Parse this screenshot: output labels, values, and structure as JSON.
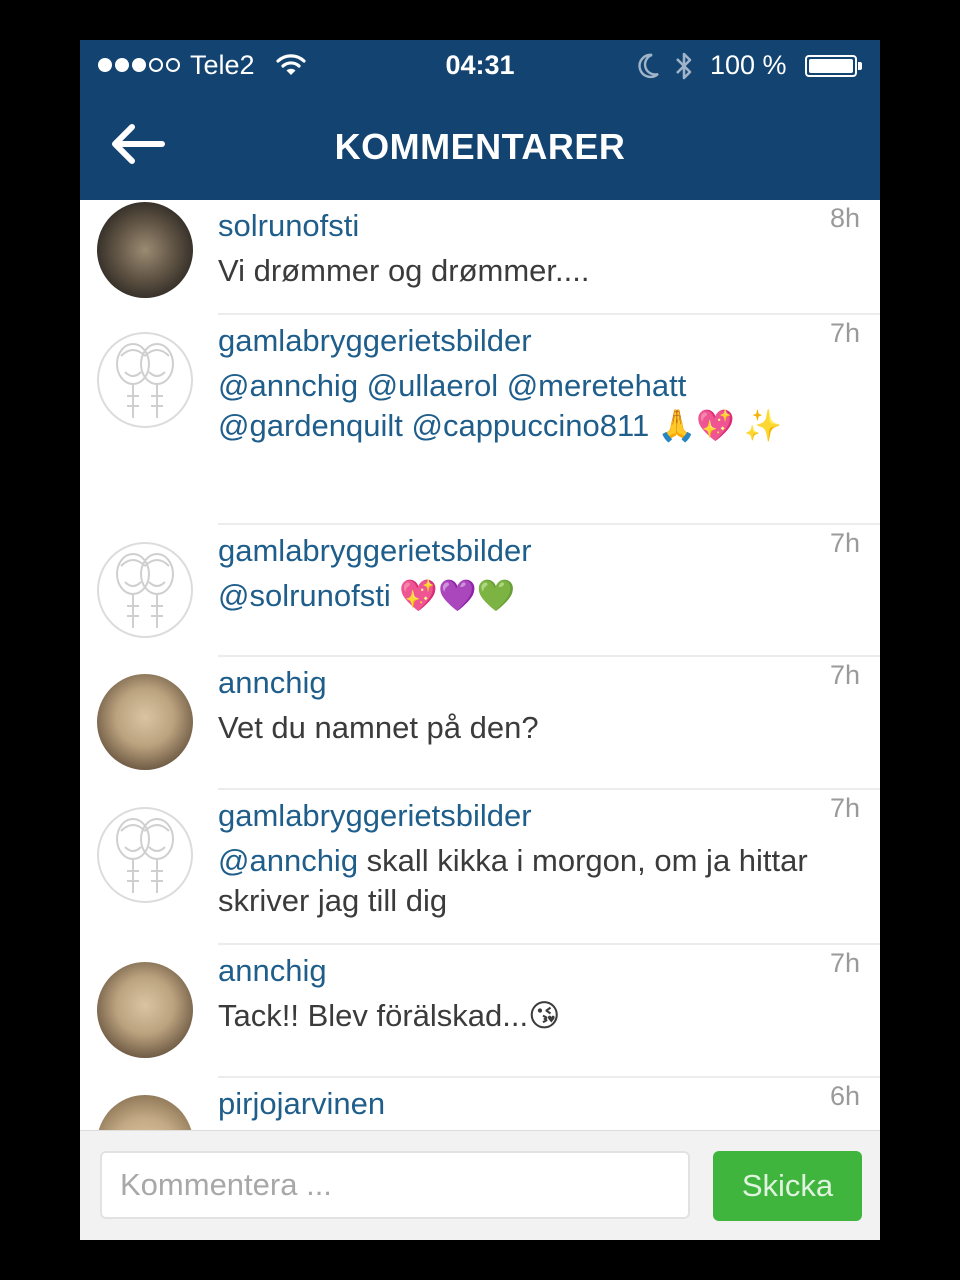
{
  "status_bar": {
    "carrier": "Tele2",
    "time": "04:31",
    "battery": "100 %"
  },
  "header": {
    "title": "KOMMENTARER"
  },
  "comments": [
    {
      "user": "solrunofsti",
      "time": "8h",
      "avatar": "photo-dark",
      "parts": [
        {
          "t": "Vi drømmer og drømmer....",
          "m": false
        }
      ]
    },
    {
      "user": "gamlabryggerietsbilder",
      "time": "7h",
      "avatar": "logo",
      "parts": [
        {
          "t": "@annchig @ullaerol @meretehatt @gardenquilt @cappuccino811 🙏💖 ✨",
          "m": true
        }
      ]
    },
    {
      "user": "gamlabryggerietsbilder",
      "time": "7h",
      "avatar": "logo",
      "parts": [
        {
          "t": "@solrunofsti",
          "m": true
        },
        {
          "t": " 💖💜💚",
          "m": false
        }
      ]
    },
    {
      "user": "annchig",
      "time": "7h",
      "avatar": "photo",
      "parts": [
        {
          "t": "Vet du namnet på den?",
          "m": false
        }
      ]
    },
    {
      "user": "gamlabryggerietsbilder",
      "time": "7h",
      "avatar": "logo",
      "parts": [
        {
          "t": "@annchig",
          "m": true
        },
        {
          "t": " skall kikka i morgon, om ja hittar skriver jag till dig",
          "m": false
        }
      ]
    },
    {
      "user": "annchig",
      "time": "7h",
      "avatar": "photo",
      "parts": [
        {
          "t": "Tack!! Blev förälskad...😘",
          "m": false
        }
      ]
    },
    {
      "user": "pirjojarvinen",
      "time": "6h",
      "avatar": "photo-blond",
      "parts": []
    }
  ],
  "composer": {
    "placeholder": "Kommentera ...",
    "send_label": "Skicka"
  },
  "colors": {
    "header_bg": "#134370",
    "username": "#1f5e8b",
    "send_button": "#3fb53d"
  }
}
